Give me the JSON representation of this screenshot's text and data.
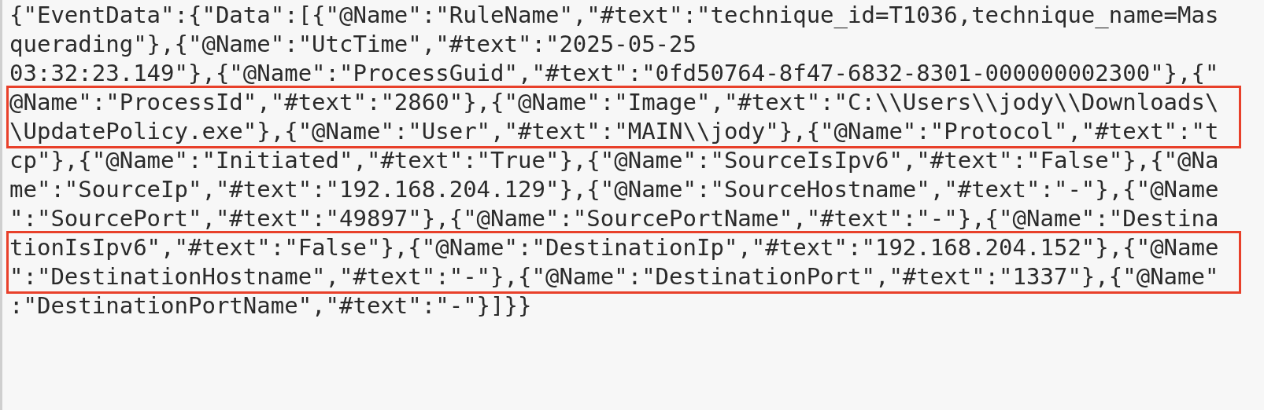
{
  "blocks": [
    {
      "highlighted": false,
      "lines": [
        "{\"EventData\":{\"Data\":[{\"@Name\":\"RuleName\",\"#text\":\"technique_id=T1036,technique_name=Mas",
        "querading\"},{\"@Name\":\"UtcTime\",\"#text\":\"2025-05-25",
        "03:32:23.149\"},{\"@Name\":\"ProcessGuid\",\"#text\":\"0fd50764-8f47-6832-8301-000000002300\"},{\""
      ]
    },
    {
      "highlighted": true,
      "lines": [
        "@Name\":\"ProcessId\",\"#text\":\"2860\"},{\"@Name\":\"Image\",\"#text\":\"C:\\\\Users\\\\jody\\\\Downloads\\",
        "\\UpdatePolicy.exe\"},{\"@Name\":\"User\",\"#text\":\"MAIN\\\\jody\"},{\"@Name\":\"Protocol\",\"#text\":\"t"
      ]
    },
    {
      "highlighted": false,
      "lines": [
        "cp\"},{\"@Name\":\"Initiated\",\"#text\":\"True\"},{\"@Name\":\"SourceIsIpv6\",\"#text\":\"False\"},{\"@Na",
        "me\":\"SourceIp\",\"#text\":\"192.168.204.129\"},{\"@Name\":\"SourceHostname\",\"#text\":\"-\"},{\"@Name",
        "\":\"SourcePort\",\"#text\":\"49897\"},{\"@Name\":\"SourcePortName\",\"#text\":\"-\"},{\"@Name\":\"Destina"
      ]
    },
    {
      "highlighted": true,
      "lines": [
        "tionIsIpv6\",\"#text\":\"False\"},{\"@Name\":\"DestinationIp\",\"#text\":\"192.168.204.152\"},{\"@Name",
        "\":\"DestinationHostname\",\"#text\":\"-\"},{\"@Name\":\"DestinationPort\",\"#text\":\"1337\"},{\"@Name\""
      ]
    },
    {
      "highlighted": false,
      "lines": [
        ":\"DestinationPortName\",\"#text\":\"-\"}]}}"
      ]
    }
  ]
}
